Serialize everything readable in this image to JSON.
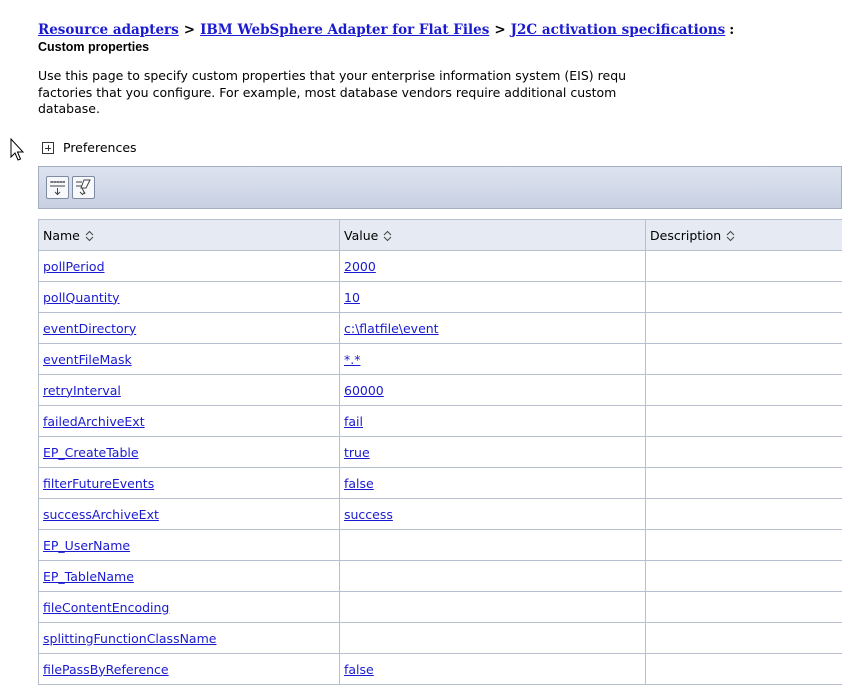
{
  "breadcrumb": {
    "items": [
      "Resource adapters",
      "IBM WebSphere Adapter for Flat Files",
      "J2C activation specifications"
    ],
    "separator": ">",
    "trailing": ":"
  },
  "page_title": "Custom properties",
  "description": {
    "lines": [
      "Use this page to specify custom properties that your enterprise information system (EIS) requ",
      "factories that you configure. For example, most database vendors require additional custom",
      "database."
    ]
  },
  "preferences": {
    "label": "Preferences"
  },
  "toolbar": {
    "icons": [
      "select-all-icon",
      "deselect-all-icon"
    ]
  },
  "table": {
    "columns": [
      "Name",
      "Value",
      "Description"
    ],
    "rows": [
      {
        "name": "pollPeriod",
        "value": "2000",
        "description": ""
      },
      {
        "name": "pollQuantity",
        "value": "10",
        "description": ""
      },
      {
        "name": "eventDirectory",
        "value": "c:\\flatfile\\event",
        "description": ""
      },
      {
        "name": "eventFileMask",
        "value": "*.*",
        "description": ""
      },
      {
        "name": "retryInterval",
        "value": "60000",
        "description": ""
      },
      {
        "name": "failedArchiveExt",
        "value": "fail",
        "description": ""
      },
      {
        "name": "EP_CreateTable",
        "value": "true",
        "description": ""
      },
      {
        "name": "filterFutureEvents",
        "value": "false",
        "description": ""
      },
      {
        "name": "successArchiveExt",
        "value": "success",
        "description": ""
      },
      {
        "name": "EP_UserName",
        "value": "",
        "description": ""
      },
      {
        "name": "EP_TableName",
        "value": "",
        "description": ""
      },
      {
        "name": "fileContentEncoding",
        "value": "",
        "description": ""
      },
      {
        "name": "splittingFunctionClassName",
        "value": "",
        "description": ""
      },
      {
        "name": "filePassByReference",
        "value": "false",
        "description": ""
      }
    ]
  },
  "colors": {
    "link": "#1a1ad0",
    "header_bg": "#e6ebf3",
    "border": "#b7bfcf",
    "toolbar_bg": "#d3d9e8"
  }
}
